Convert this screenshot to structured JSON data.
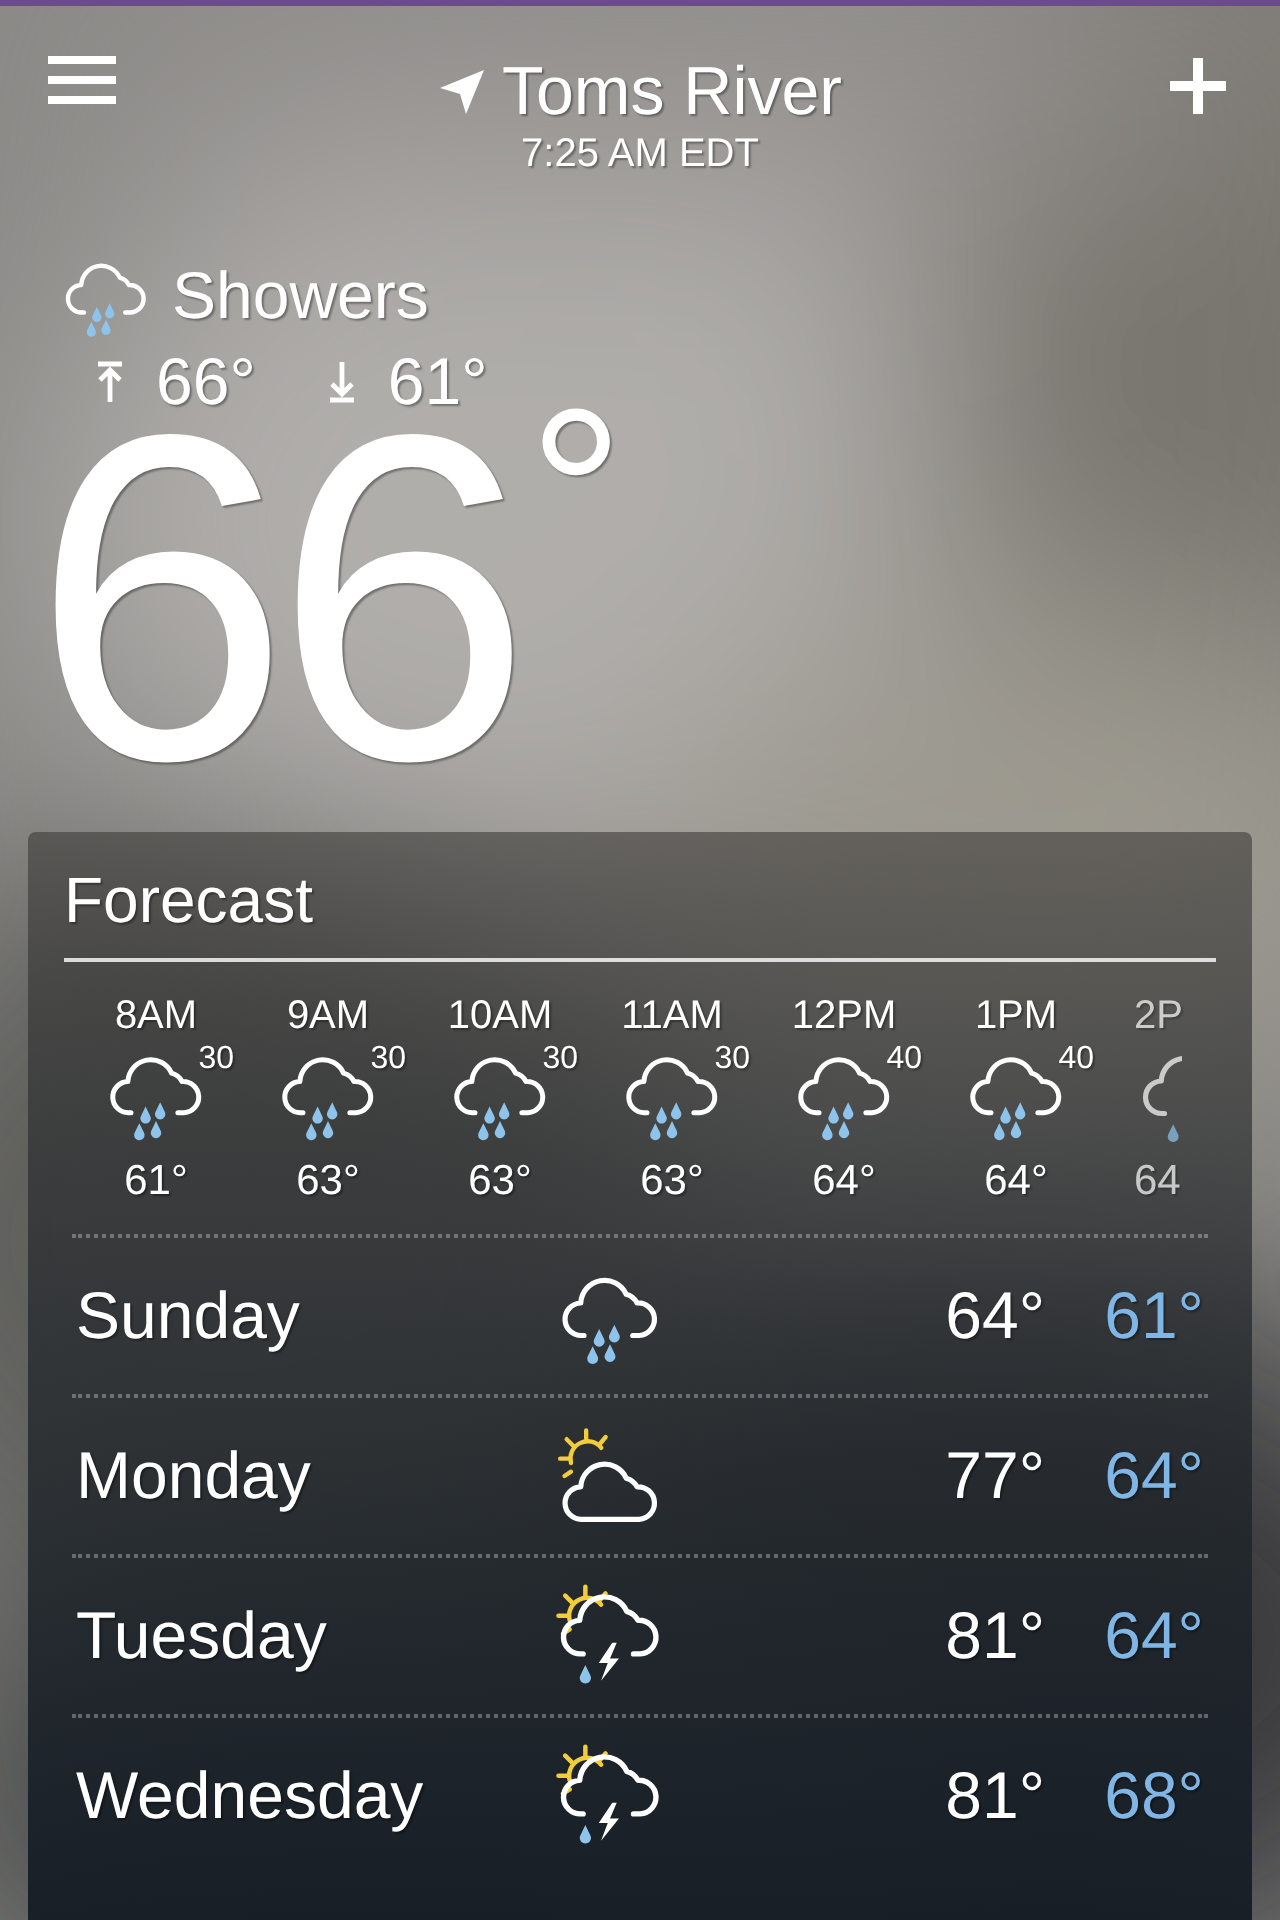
{
  "header": {
    "location": "Toms River",
    "time": "7:25 AM EDT"
  },
  "current": {
    "condition": "Showers",
    "high": "66°",
    "low": "61°",
    "temperature": "66",
    "degree": "°"
  },
  "forecast": {
    "title": "Forecast",
    "hourly": [
      {
        "time": "8AM",
        "precip": "30",
        "temp": "61°"
      },
      {
        "time": "9AM",
        "precip": "30",
        "temp": "63°"
      },
      {
        "time": "10AM",
        "precip": "30",
        "temp": "63°"
      },
      {
        "time": "11AM",
        "precip": "30",
        "temp": "63°"
      },
      {
        "time": "12PM",
        "precip": "40",
        "temp": "64°"
      },
      {
        "time": "1PM",
        "precip": "40",
        "temp": "64°"
      },
      {
        "time": "2P",
        "temp": "64"
      }
    ],
    "daily": [
      {
        "day": "Sunday",
        "kind": "showers",
        "high": "64°",
        "low": "61°"
      },
      {
        "day": "Monday",
        "kind": "partly-cloudy",
        "high": "77°",
        "low": "64°"
      },
      {
        "day": "Tuesday",
        "kind": "sun-storm",
        "high": "81°",
        "low": "64°"
      },
      {
        "day": "Wednesday",
        "kind": "sun-storm",
        "high": "81°",
        "low": "68°"
      }
    ]
  }
}
